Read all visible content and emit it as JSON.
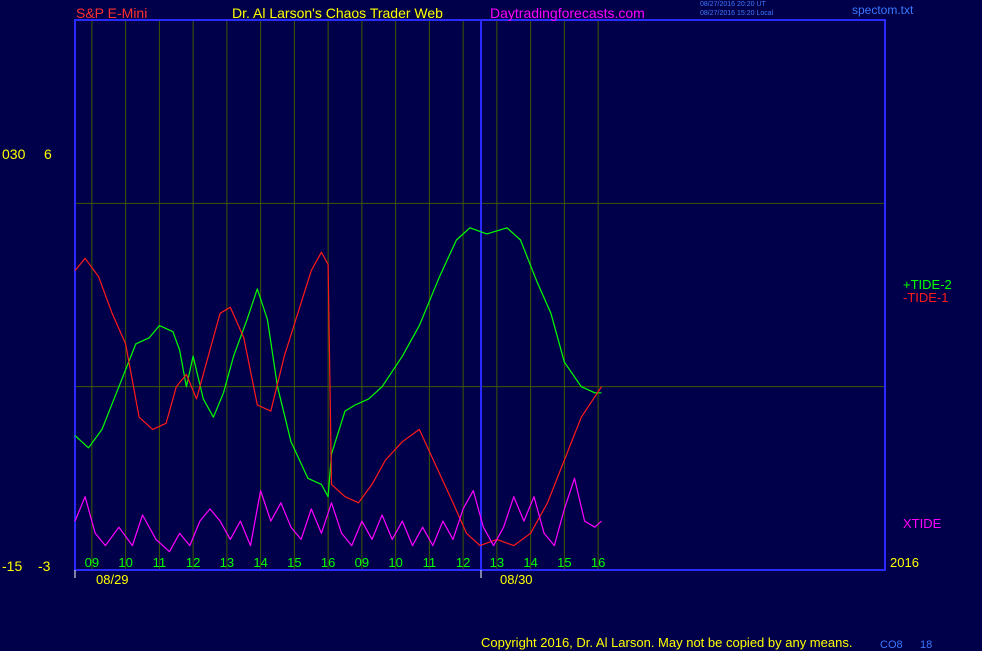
{
  "header": {
    "left_title": "S&P E-Mini",
    "center_title": "Dr. Al Larson's Chaos Trader Web",
    "site": "Daytradingforecasts.com",
    "time_utc": "08/27/2016 20:20 UT",
    "time_local": "08/27/2016 15:20 Local",
    "file": "spectom.txt"
  },
  "colors": {
    "background": "#00004a",
    "frame": "#2a2aff",
    "grid": "#3c5a00",
    "tide2": "#00ff00",
    "tide1": "#ff1a1a",
    "xtide": "#ff00ff",
    "hour_label": "#00ff00",
    "axis_text": "#ffff00"
  },
  "axis": {
    "top_left": "030",
    "top_scale": "6",
    "bottom_left": "-15",
    "bottom_scale": "-3",
    "year": "2016"
  },
  "footer": {
    "copyright": "Copyright 2016, Dr. Al Larson. May not be copied by any means.",
    "page_code": "CO8",
    "page_num": "18"
  },
  "chart_data": {
    "type": "line",
    "y_scale": "6 to -3",
    "ylim": [
      -3,
      6
    ],
    "days": [
      {
        "date": "08/29",
        "hours": [
          "09",
          "10",
          "11",
          "12",
          "13",
          "14",
          "15",
          "16"
        ]
      },
      {
        "date": "08/30",
        "hours": [
          "09",
          "10",
          "11",
          "12",
          "13",
          "14",
          "15",
          "16"
        ]
      }
    ],
    "x_range_hours": [
      8.5,
      32.5
    ],
    "series": [
      {
        "name": "+TIDE-2",
        "color": "#00ff00",
        "points": [
          [
            8.5,
            -0.8
          ],
          [
            8.9,
            -1.0
          ],
          [
            9.3,
            -0.7
          ],
          [
            9.8,
            0.0
          ],
          [
            10.3,
            0.7
          ],
          [
            10.7,
            0.8
          ],
          [
            11.0,
            1.0
          ],
          [
            11.4,
            0.9
          ],
          [
            11.6,
            0.6
          ],
          [
            11.8,
            0.0
          ],
          [
            12.0,
            0.5
          ],
          [
            12.3,
            -0.2
          ],
          [
            12.6,
            -0.5
          ],
          [
            12.9,
            -0.1
          ],
          [
            13.2,
            0.5
          ],
          [
            13.6,
            1.1
          ],
          [
            13.9,
            1.6
          ],
          [
            14.2,
            1.1
          ],
          [
            14.5,
            0.0
          ],
          [
            14.9,
            -0.9
          ],
          [
            15.4,
            -1.5
          ],
          [
            15.8,
            -1.6
          ],
          [
            16.0,
            -1.8
          ],
          [
            16.1,
            -1.1
          ],
          [
            16.5,
            -0.4
          ],
          [
            16.8,
            -0.3
          ],
          [
            17.2,
            -0.2
          ],
          [
            17.6,
            0.0
          ],
          [
            18.2,
            0.5
          ],
          [
            18.7,
            1.0
          ],
          [
            19.3,
            1.8
          ],
          [
            19.8,
            2.4
          ],
          [
            20.2,
            2.6
          ],
          [
            20.7,
            2.5
          ],
          [
            21.3,
            2.6
          ],
          [
            21.7,
            2.4
          ],
          [
            22.2,
            1.7
          ],
          [
            22.6,
            1.2
          ],
          [
            23.0,
            0.4
          ],
          [
            23.5,
            0.0
          ],
          [
            23.9,
            -0.1
          ],
          [
            24.1,
            -0.1
          ]
        ]
      },
      {
        "name": "-TIDE-1",
        "color": "#ff1a1a",
        "points": [
          [
            8.5,
            1.9
          ],
          [
            8.8,
            2.1
          ],
          [
            9.2,
            1.8
          ],
          [
            9.6,
            1.2
          ],
          [
            10.0,
            0.7
          ],
          [
            10.4,
            -0.5
          ],
          [
            10.8,
            -0.7
          ],
          [
            11.2,
            -0.6
          ],
          [
            11.5,
            0.0
          ],
          [
            11.8,
            0.2
          ],
          [
            12.1,
            -0.2
          ],
          [
            12.4,
            0.4
          ],
          [
            12.8,
            1.2
          ],
          [
            13.1,
            1.3
          ],
          [
            13.5,
            0.8
          ],
          [
            13.9,
            -0.3
          ],
          [
            14.3,
            -0.4
          ],
          [
            14.7,
            0.5
          ],
          [
            15.1,
            1.2
          ],
          [
            15.5,
            1.9
          ],
          [
            15.8,
            2.2
          ],
          [
            16.0,
            2.0
          ],
          [
            16.1,
            -1.6
          ],
          [
            16.5,
            -1.8
          ],
          [
            16.9,
            -1.9
          ],
          [
            17.3,
            -1.6
          ],
          [
            17.7,
            -1.2
          ],
          [
            18.2,
            -0.9
          ],
          [
            18.7,
            -0.7
          ],
          [
            19.2,
            -1.3
          ],
          [
            19.7,
            -1.9
          ],
          [
            20.1,
            -2.4
          ],
          [
            20.5,
            -2.6
          ],
          [
            21.0,
            -2.5
          ],
          [
            21.5,
            -2.6
          ],
          [
            22.0,
            -2.4
          ],
          [
            22.5,
            -1.9
          ],
          [
            23.0,
            -1.2
          ],
          [
            23.5,
            -0.5
          ],
          [
            24.1,
            0.0
          ]
        ]
      },
      {
        "name": "XTIDE",
        "color": "#ff00ff",
        "points": [
          [
            8.5,
            -2.2
          ],
          [
            8.8,
            -1.8
          ],
          [
            9.1,
            -2.4
          ],
          [
            9.4,
            -2.6
          ],
          [
            9.8,
            -2.3
          ],
          [
            10.2,
            -2.6
          ],
          [
            10.5,
            -2.1
          ],
          [
            10.9,
            -2.5
          ],
          [
            11.3,
            -2.7
          ],
          [
            11.6,
            -2.4
          ],
          [
            11.9,
            -2.6
          ],
          [
            12.2,
            -2.2
          ],
          [
            12.5,
            -2.0
          ],
          [
            12.8,
            -2.2
          ],
          [
            13.1,
            -2.5
          ],
          [
            13.4,
            -2.2
          ],
          [
            13.7,
            -2.6
          ],
          [
            14.0,
            -1.7
          ],
          [
            14.3,
            -2.2
          ],
          [
            14.6,
            -1.9
          ],
          [
            14.9,
            -2.3
          ],
          [
            15.2,
            -2.5
          ],
          [
            15.5,
            -2.0
          ],
          [
            15.8,
            -2.4
          ],
          [
            16.1,
            -1.9
          ],
          [
            16.4,
            -2.4
          ],
          [
            16.7,
            -2.6
          ],
          [
            17.0,
            -2.2
          ],
          [
            17.3,
            -2.5
          ],
          [
            17.6,
            -2.1
          ],
          [
            17.9,
            -2.5
          ],
          [
            18.2,
            -2.2
          ],
          [
            18.5,
            -2.6
          ],
          [
            18.8,
            -2.3
          ],
          [
            19.1,
            -2.6
          ],
          [
            19.4,
            -2.2
          ],
          [
            19.7,
            -2.5
          ],
          [
            20.0,
            -2.0
          ],
          [
            20.3,
            -1.7
          ],
          [
            20.6,
            -2.3
          ],
          [
            20.9,
            -2.6
          ],
          [
            21.2,
            -2.3
          ],
          [
            21.5,
            -1.8
          ],
          [
            21.8,
            -2.2
          ],
          [
            22.1,
            -1.8
          ],
          [
            22.4,
            -2.4
          ],
          [
            22.7,
            -2.6
          ],
          [
            23.0,
            -2.0
          ],
          [
            23.3,
            -1.5
          ],
          [
            23.6,
            -2.2
          ],
          [
            23.9,
            -2.3
          ],
          [
            24.1,
            -2.2
          ]
        ]
      }
    ]
  }
}
